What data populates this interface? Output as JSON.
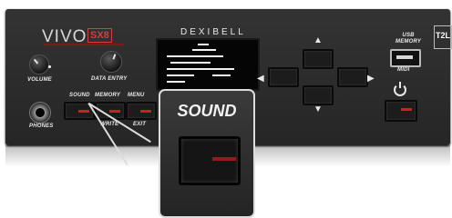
{
  "panel": {
    "brand": "VIVO",
    "model": "SX8",
    "logo": "DEXIBELL",
    "labels": {
      "volume": "VOLUME",
      "data_entry": "DATA ENTRY",
      "sound": "SOUND",
      "memory": "MEMORY",
      "menu": "MENU",
      "write": "WRITE",
      "exit": "EXIT",
      "phones": "PHONES",
      "usb_memory": "USB\nMEMORY",
      "midi": "MIDI",
      "t2l": "T2L"
    }
  },
  "callout": {
    "title": "SOUND"
  },
  "colors": {
    "panel": "#2b2b2b",
    "led_red": "#cc1f1f",
    "callout_border": "#dcdcdc"
  }
}
